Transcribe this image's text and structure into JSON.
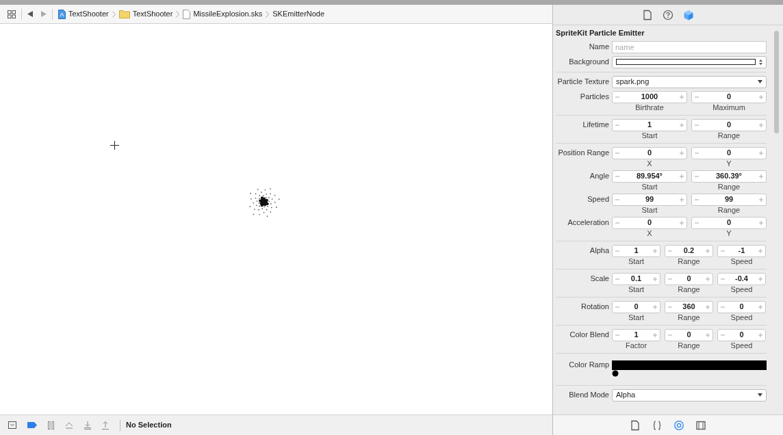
{
  "breadcrumb": [
    {
      "kind": "project",
      "label": "TextShooter"
    },
    {
      "kind": "folder",
      "label": "TextShooter"
    },
    {
      "kind": "file",
      "label": "MissileExplosion.sks"
    },
    {
      "kind": "node",
      "label": "SKEmitterNode"
    }
  ],
  "inspector_tabs": [
    {
      "kind": "file",
      "selected": false
    },
    {
      "kind": "help",
      "selected": false
    },
    {
      "kind": "cube",
      "selected": true
    }
  ],
  "inspector": {
    "title": "SpriteKit Particle Emitter",
    "sections": [
      [
        {
          "kind": "text",
          "label": "Name",
          "placeholder": "name"
        },
        {
          "kind": "swatch",
          "label": "Background"
        }
      ],
      [
        {
          "kind": "popup",
          "label": "Particle Texture",
          "value": "spark.png"
        },
        {
          "kind": "stepper",
          "label": "Particles",
          "fields": [
            {
              "value": "1000",
              "caption": "Birthrate"
            },
            {
              "value": "0",
              "caption": "Maximum"
            }
          ]
        }
      ],
      [
        {
          "kind": "stepper",
          "label": "Lifetime",
          "fields": [
            {
              "value": "1",
              "caption": "Start"
            },
            {
              "value": "0",
              "caption": "Range"
            }
          ]
        }
      ],
      [
        {
          "kind": "stepper",
          "label": "Position Range",
          "fields": [
            {
              "value": "0",
              "caption": "X"
            },
            {
              "value": "0",
              "caption": "Y"
            }
          ]
        },
        {
          "kind": "stepper",
          "label": "Angle",
          "fields": [
            {
              "value": "89.954°",
              "caption": "Start"
            },
            {
              "value": "360.39°",
              "caption": "Range"
            }
          ]
        },
        {
          "kind": "stepper",
          "label": "Speed",
          "fields": [
            {
              "value": "99",
              "caption": "Start"
            },
            {
              "value": "99",
              "caption": "Range"
            }
          ]
        },
        {
          "kind": "stepper",
          "label": "Acceleration",
          "fields": [
            {
              "value": "0",
              "caption": "X"
            },
            {
              "value": "0",
              "caption": "Y"
            }
          ]
        }
      ],
      [
        {
          "kind": "stepper",
          "label": "Alpha",
          "fields": [
            {
              "value": "1",
              "caption": "Start"
            },
            {
              "value": "0.2",
              "caption": "Range"
            },
            {
              "value": "-1",
              "caption": "Speed"
            }
          ]
        }
      ],
      [
        {
          "kind": "stepper",
          "label": "Scale",
          "fields": [
            {
              "value": "0.1",
              "caption": "Start"
            },
            {
              "value": "0",
              "caption": "Range"
            },
            {
              "value": "-0.4",
              "caption": "Speed"
            }
          ]
        }
      ],
      [
        {
          "kind": "stepper",
          "label": "Rotation",
          "fields": [
            {
              "value": "0",
              "caption": "Start"
            },
            {
              "value": "360",
              "caption": "Range"
            },
            {
              "value": "0",
              "caption": "Speed"
            }
          ]
        }
      ],
      [
        {
          "kind": "stepper",
          "label": "Color Blend",
          "fields": [
            {
              "value": "1",
              "caption": "Factor"
            },
            {
              "value": "0",
              "caption": "Range"
            },
            {
              "value": "0",
              "caption": "Speed"
            }
          ]
        }
      ],
      [
        {
          "kind": "ramp",
          "label": "Color Ramp",
          "color": "#000000"
        }
      ],
      [
        {
          "kind": "popup",
          "label": "Blend Mode",
          "value": "Alpha"
        }
      ]
    ]
  },
  "library_tabs": [
    {
      "kind": "file",
      "selected": false
    },
    {
      "kind": "braces",
      "selected": false
    },
    {
      "kind": "target",
      "selected": true
    },
    {
      "kind": "media",
      "selected": false
    }
  ],
  "status": "No Selection"
}
